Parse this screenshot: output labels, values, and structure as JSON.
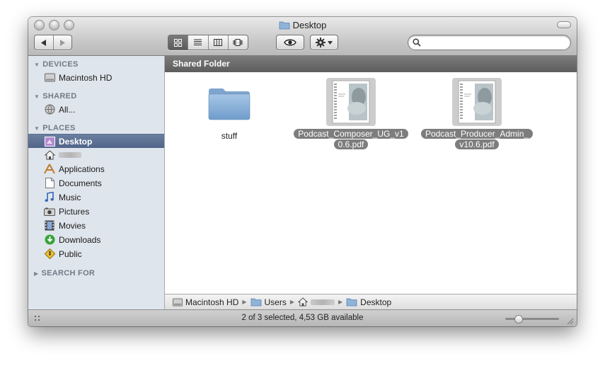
{
  "window": {
    "title": "Desktop"
  },
  "sidebar": {
    "devices_label": "DEVICES",
    "devices": [
      {
        "label": "Macintosh HD",
        "icon": "hard-drive-icon"
      }
    ],
    "shared_label": "SHARED",
    "shared": [
      {
        "label": "All...",
        "icon": "network-globe-icon"
      }
    ],
    "places_label": "PLACES",
    "places": [
      {
        "label": "Desktop",
        "icon": "desktop-icon",
        "selected": true
      },
      {
        "label": "",
        "icon": "home-icon"
      },
      {
        "label": "Applications",
        "icon": "applications-icon"
      },
      {
        "label": "Documents",
        "icon": "documents-icon"
      },
      {
        "label": "Music",
        "icon": "music-icon"
      },
      {
        "label": "Pictures",
        "icon": "pictures-icon"
      },
      {
        "label": "Movies",
        "icon": "movies-icon"
      },
      {
        "label": "Downloads",
        "icon": "downloads-icon"
      },
      {
        "label": "Public",
        "icon": "public-icon"
      }
    ],
    "search_for_label": "SEARCH FOR"
  },
  "content": {
    "header": "Shared Folder",
    "files": [
      {
        "name": "stuff",
        "type": "folder",
        "selected": false
      },
      {
        "name_line1": "Podcast_Composer_UG_v1",
        "name_line2": "0.6.pdf",
        "type": "pdf",
        "selected": true
      },
      {
        "name_line1": "Podcast_Producer_Admin_",
        "name_line2": "v10.6.pdf",
        "type": "pdf",
        "selected": true
      }
    ]
  },
  "pathbar": {
    "segments": [
      {
        "label": "Macintosh HD",
        "icon": "hard-drive-icon"
      },
      {
        "label": "Users",
        "icon": "folder-icon"
      },
      {
        "label": "",
        "icon": "home-icon"
      },
      {
        "label": "Desktop",
        "icon": "folder-icon"
      }
    ]
  },
  "status": {
    "text": "2 of 3 selected, 4,53 GB available",
    "icon_size_fraction": 0.2
  },
  "search": {
    "placeholder": "",
    "value": ""
  },
  "colors": {
    "selection": "#51648a",
    "sidebar_bg": "#dfe5ec",
    "header_bg": "#6a6a6a",
    "file_label_selected": "#7d7d7d"
  }
}
